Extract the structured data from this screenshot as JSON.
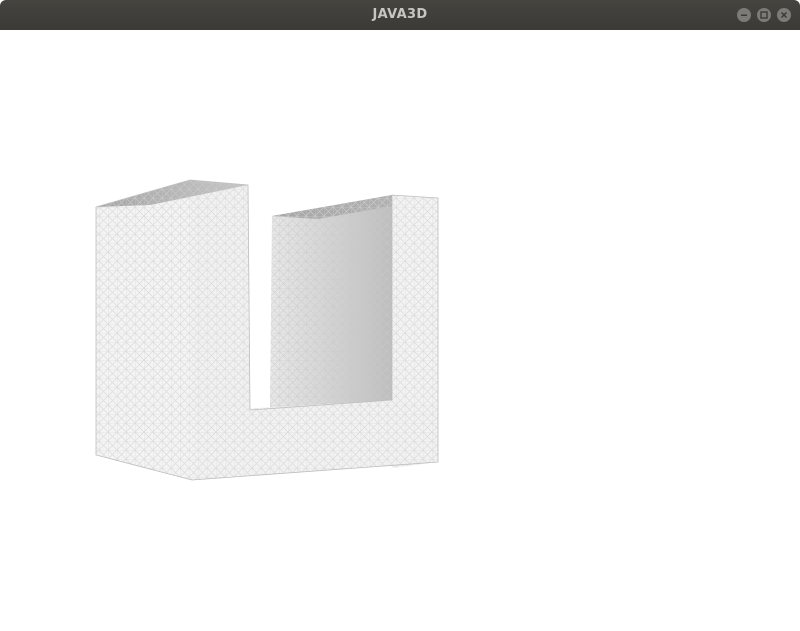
{
  "window": {
    "title": "JAVA3D"
  },
  "titlebar_buttons": {
    "minimize": "minimize-icon",
    "maximize": "maximize-icon",
    "close": "close-icon"
  },
  "scene": {
    "object": "u-shaped-wireframe-block",
    "background_color": "#ffffff",
    "mesh_color": "#c8c8c8"
  },
  "colors": {
    "titlebar": "#3f3e3a",
    "title_text": "#c7c6c2",
    "window_button": "#7c7b77"
  }
}
